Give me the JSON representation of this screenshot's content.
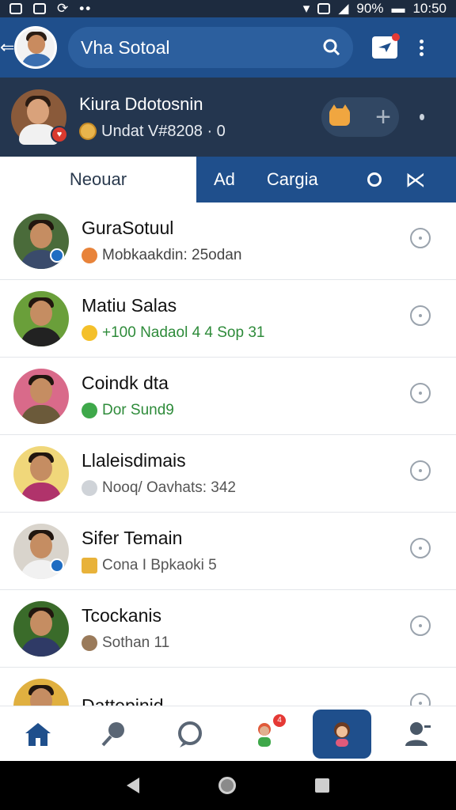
{
  "status_bar": {
    "battery": "90%",
    "time": "10:50"
  },
  "app_bar": {
    "title": "Vha Sotoal"
  },
  "profile": {
    "name": "Kiura Ddotosnin",
    "subtitle": "Undat V#8208 · 0"
  },
  "tabs": {
    "active": "Neouar",
    "ad": "Ad",
    "cargia": "Cargia"
  },
  "chats": [
    {
      "name": "GuraSotuul",
      "preview": "Mobkaakdin: 25odan",
      "preview_color": "#444444",
      "avatar_bg": "#4a6b3a",
      "body_color": "#3a4b6b"
    },
    {
      "name": "Matiu Salas",
      "preview": "+100  Nadaol 4 4 Sop 31",
      "preview_color": "#2e8b3a",
      "avatar_bg": "#6a9f3a",
      "body_color": "#222222"
    },
    {
      "name": "Coindk dta",
      "preview": "Dor  Sund9",
      "preview_color": "#2e8b3a",
      "avatar_bg": "#d96a8a",
      "body_color": "#6b5a3a"
    },
    {
      "name": "Llaleisdimais",
      "preview": "Nooq/ Oavhats: 342",
      "preview_color": "#555555",
      "avatar_bg": "#f0d77a",
      "body_color": "#b0336b"
    },
    {
      "name": "Sifer Temain",
      "preview": "Cona  I Bpkaoki 5",
      "preview_color": "#555555",
      "avatar_bg": "#d9d4cc",
      "body_color": "#f1f1f1"
    },
    {
      "name": "Tcockanis",
      "preview": "Sothan  11",
      "preview_color": "#555555",
      "avatar_bg": "#3a6b2a",
      "body_color": "#2f3a66"
    },
    {
      "name": "Dattepinid",
      "preview": "",
      "preview_color": "#555555",
      "avatar_bg": "#e0b040",
      "body_color": "#3a3a3a"
    }
  ],
  "bottom_nav": {
    "items": [
      "home-icon",
      "search-icon",
      "chat-bubble-icon",
      "people-icon",
      "profile-girl-icon",
      "account-icon"
    ],
    "badge": "4"
  },
  "colors": {
    "primary": "#1f4f8c",
    "dark_band": "#24364f",
    "accent_red": "#e53935"
  }
}
